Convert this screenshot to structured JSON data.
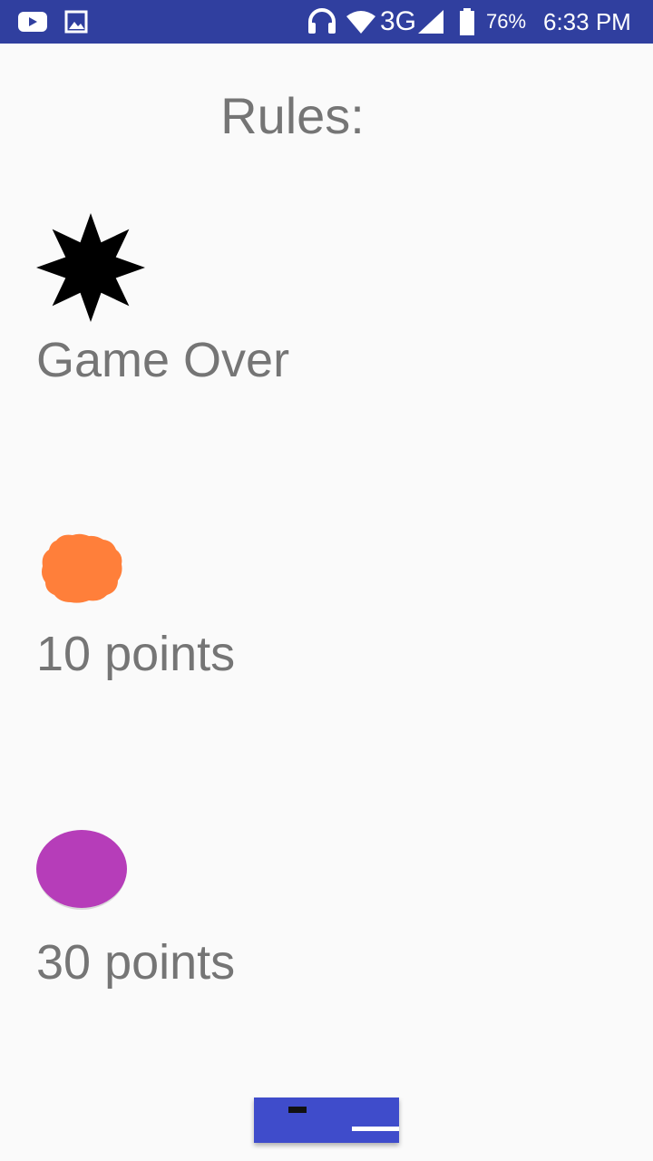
{
  "status_bar": {
    "battery": "76%",
    "time": "6:33 PM",
    "network": "3G",
    "icons": [
      "youtube-icon",
      "image-icon",
      "headset-icon",
      "wifi-icon",
      "signal-icon",
      "battery-icon"
    ]
  },
  "title": "Rules:",
  "rules": [
    {
      "icon": "black-star-bomb-icon",
      "label": "Game Over"
    },
    {
      "icon": "orange-blob-icon",
      "label": "10 points"
    },
    {
      "icon": "purple-ball-icon",
      "label": "30 points"
    }
  ],
  "colors": {
    "status_bar": "#303f9f",
    "text": "#757575",
    "orange": "#ff7f3a",
    "purple": "#b63db9",
    "paddle": "#3f4ccb"
  }
}
